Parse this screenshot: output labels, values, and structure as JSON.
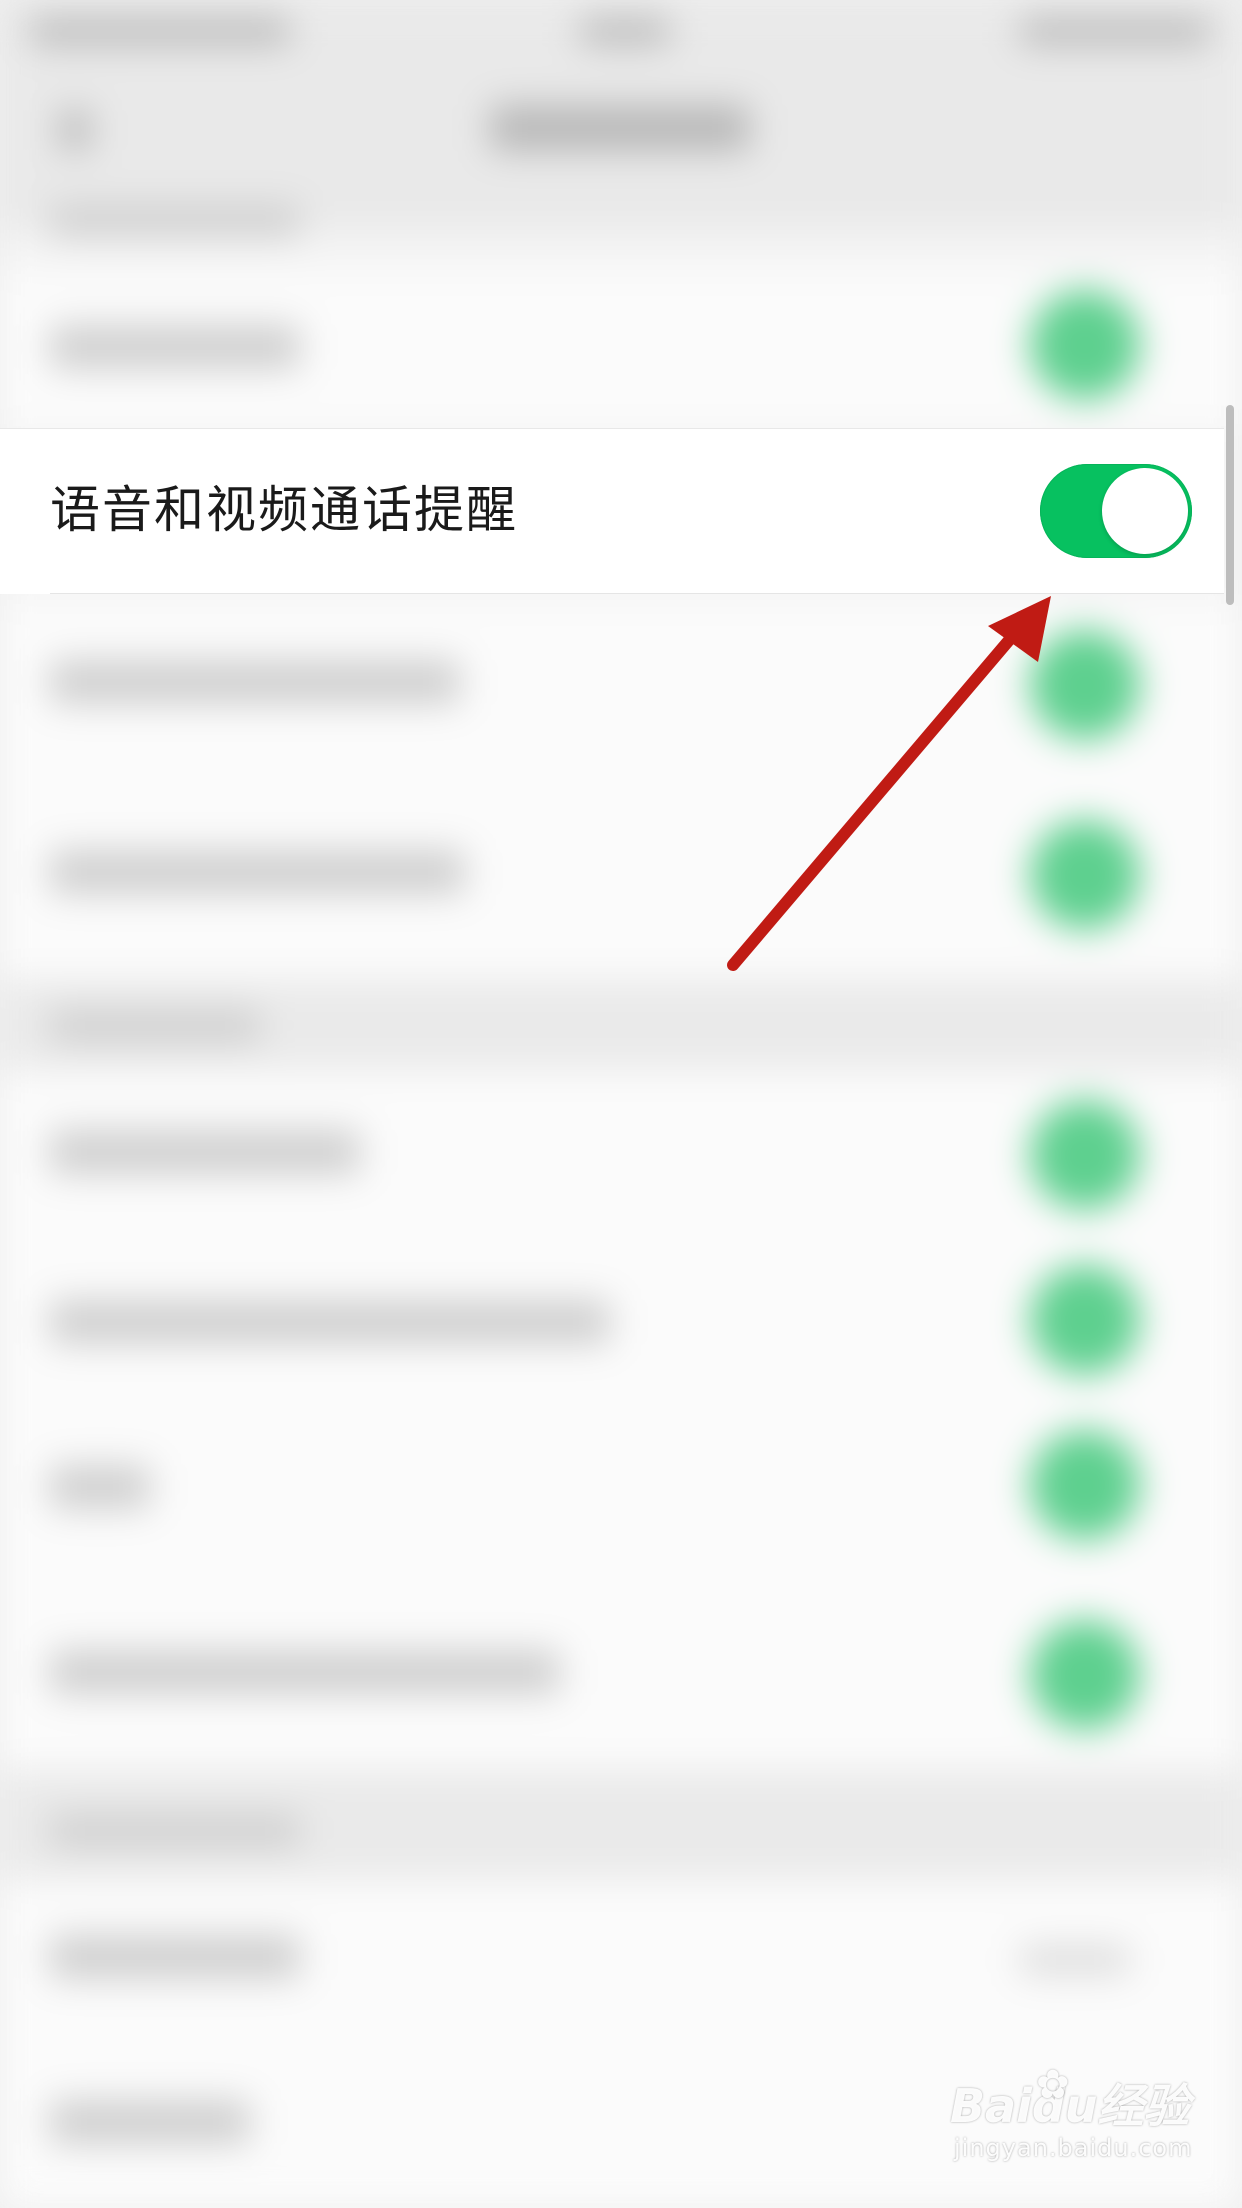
{
  "setting": {
    "label": "语音和视频通话提醒",
    "enabled": true
  },
  "colors": {
    "toggle_on": "#07c160",
    "arrow": "#c01b14",
    "label_text": "#1a1a1a",
    "blurred_toggle": "#5ed08f"
  },
  "watermark": {
    "brand": "Baidu经验",
    "url": "jingyan.baidu.com"
  }
}
